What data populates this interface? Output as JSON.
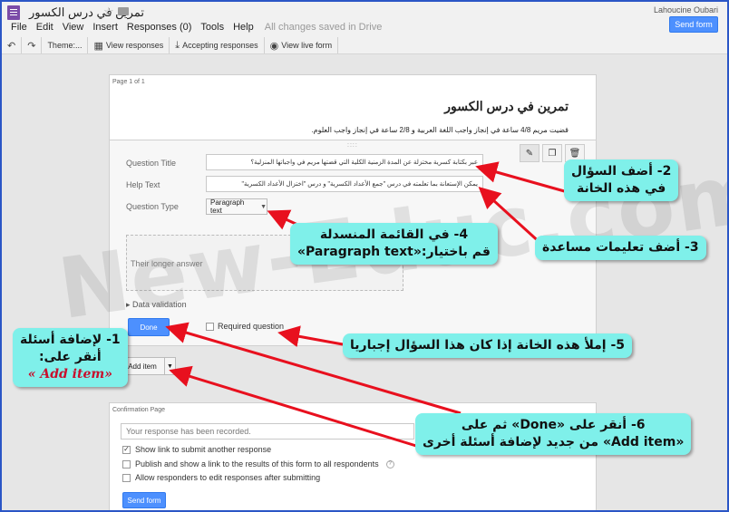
{
  "topbar": {
    "doc_title": "تمرين في درس الكسور",
    "user_name": "Lahoucine Oubari",
    "send_form": "Send form",
    "menu": [
      "File",
      "Edit",
      "View",
      "Insert",
      "Responses (0)",
      "Tools",
      "Help"
    ],
    "saved_status": "All changes saved in Drive",
    "toolbar": [
      "Theme:...",
      "View responses",
      "Accepting responses",
      "View live form"
    ]
  },
  "page": {
    "label": "Page 1 of 1",
    "form_title": "تمرين في درس الكسور",
    "form_description": "قضيت مريم 4/8 ساعة في إنجاز واجب اللغة العربية و 2/8 ساعة في إنجاز واجب العلوم."
  },
  "question": {
    "title_label": "Question Title",
    "title_value": "عبر بكتابة كسرية مختزلة عن المدة الزمنية الكلية التي قضتها مريم في واجباتها المنزلية؟",
    "help_label": "Help Text",
    "help_value": "يمكن الإستعانة بما تعلمته في درس \"جمع الأعداد الكسرية\" و درس \"اختزال الأعداد الكسرية\"",
    "type_label": "Question Type",
    "type_value": "Paragraph text",
    "answer_placeholder": "Their longer answer",
    "data_validation": "Data validation",
    "done": "Done",
    "required": "Required question"
  },
  "add_item": "Add item",
  "confirmation": {
    "label": "Confirmation Page",
    "message": "Your response has been recorded.",
    "options": [
      {
        "text": "Show link to submit another response",
        "checked": true
      },
      {
        "text": "Publish and show a link to the results of this form to all respondents",
        "checked": false
      },
      {
        "text": "Allow responders to edit responses after submitting",
        "checked": false
      }
    ],
    "send_form": "Send form"
  },
  "watermark": "New-Educ.com",
  "callouts": {
    "c1": {
      "line1": "1- لإضافة أسئلة",
      "line2": "أنقر على:",
      "line3": "«Add item »"
    },
    "c2": {
      "line1": "2- أضف السؤال",
      "line2": "في هذه الخانة"
    },
    "c3": "3- أضف تعليمات مساعدة",
    "c4": {
      "line1": "4- في القائمة المنسدلة",
      "line2": "قم باختيار:«Paragraph text»"
    },
    "c5": "5- إملأ هذه الخانة إذا كان هذا السؤال إجباريا",
    "c6": {
      "line1": "6- أنقر على «Done» ثم على",
      "line2": "«Add item» من جديد لإضافة أسئلة أخرى"
    }
  },
  "colors": {
    "accent": "#4d90fe",
    "callout": "#7ff0ea",
    "arrow": "#e8101e",
    "frame": "#2b56c6"
  }
}
